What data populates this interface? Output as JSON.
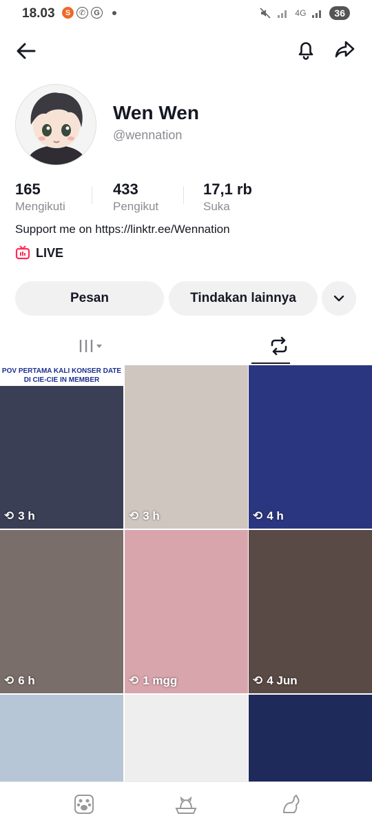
{
  "status_bar": {
    "time": "18.03",
    "network": "4G",
    "battery": "36"
  },
  "profile": {
    "display_name": "Wen Wen",
    "username": "@wennation",
    "bio": "Support me on https://linktr.ee/Wennation",
    "live_label": "LIVE"
  },
  "stats": [
    {
      "value": "165",
      "label": "Mengikuti"
    },
    {
      "value": "433",
      "label": "Pengikut"
    },
    {
      "value": "17,1 rb",
      "label": "Suka"
    }
  ],
  "buttons": {
    "message": "Pesan",
    "more_actions": "Tindakan lainnya"
  },
  "tabs": [
    {
      "icon": "grid-icon",
      "active": false
    },
    {
      "icon": "repost-icon",
      "active": true
    }
  ],
  "grid": [
    {
      "time": "3 h",
      "caption": "POV PERTAMA KALI KONSER DATE DI CIE-CIE IN MEMBER",
      "color": "#3a3f55"
    },
    {
      "time": "3 h",
      "color": "#cfc6c0"
    },
    {
      "time": "4 h",
      "color": "#2b3680"
    },
    {
      "time": "6 h",
      "color": "#7a6e6a"
    },
    {
      "time": "1 mgg",
      "color": "#d9a5ad"
    },
    {
      "time": "4 Jun",
      "color": "#5a4a45"
    },
    {
      "time": "",
      "color": "#b7c6d6"
    },
    {
      "time": "",
      "color": "#eeeeee"
    },
    {
      "time": "",
      "color": "#1d2a5a"
    }
  ],
  "colors": {
    "live_red": "#fe2c55",
    "text_primary": "#161823",
    "text_secondary": "#8a8b91",
    "button_bg": "#f1f1f2"
  }
}
